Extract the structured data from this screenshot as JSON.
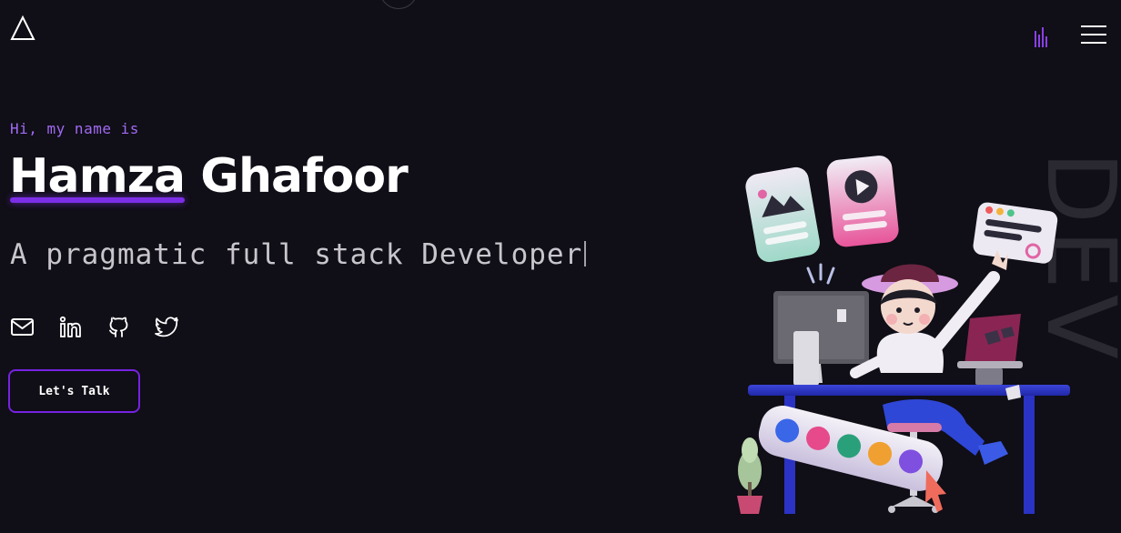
{
  "header": {
    "logo_icon": "triangle-logo-icon",
    "sound_icon": "sound-bars-icon",
    "menu_icon": "hamburger-menu-icon"
  },
  "hero": {
    "greeting": "Hi, my name is",
    "first_name": "Hamza",
    "last_name": "Ghafoor",
    "tagline": "A pragmatic full stack Developer",
    "cta_label": "Let's Talk",
    "watermark": "DEV"
  },
  "socials": [
    {
      "icon": "mail-icon"
    },
    {
      "icon": "linkedin-icon"
    },
    {
      "icon": "github-icon"
    },
    {
      "icon": "twitter-icon"
    }
  ],
  "colors": {
    "background": "#100e16",
    "accent": "#a06af3",
    "accent_border": "#7622e3",
    "text": "#ffffff",
    "muted_text": "#c8c6cc",
    "watermark": "#2a2831"
  }
}
